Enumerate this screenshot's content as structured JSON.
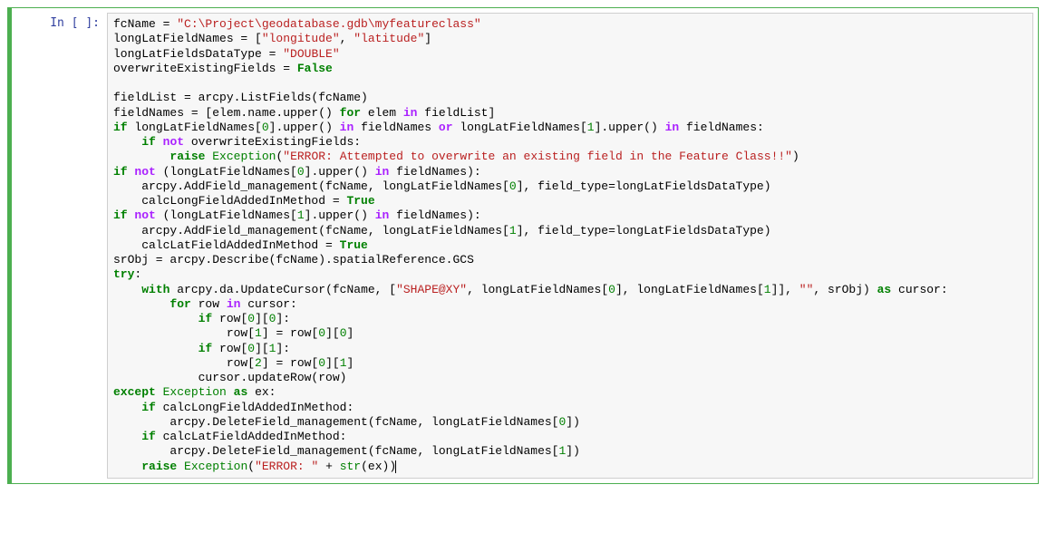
{
  "cell": {
    "prompt": "In [ ]:",
    "code": {
      "l1": {
        "a": "fcName = ",
        "b": "\"C:\\Project\\geodatabase.gdb\\myfeatureclass\""
      },
      "l2": {
        "a": "longLatFieldNames = [",
        "b": "\"longitude\"",
        "c": ", ",
        "d": "\"latitude\"",
        "e": "]"
      },
      "l3": {
        "a": "longLatFieldsDataType = ",
        "b": "\"DOUBLE\""
      },
      "l4": {
        "a": "overwriteExistingFields = ",
        "b": "False"
      },
      "l6": {
        "a": "fieldList = arcpy.ListFields(fcName)"
      },
      "l7": {
        "a": "fieldNames = [elem.name.upper() ",
        "b": "for",
        "c": " elem ",
        "d": "in",
        "e": " fieldList]"
      },
      "l8": {
        "a": "if",
        "b": " longLatFieldNames[",
        "c": "0",
        "d": "].upper() ",
        "e": "in",
        "f": " fieldNames ",
        "g": "or",
        "h": " longLatFieldNames[",
        "i": "1",
        "j": "].upper() ",
        "k": "in",
        "l": " fieldNames:"
      },
      "l9": {
        "a": "    ",
        "b": "if",
        "c": " ",
        "d": "not",
        "e": " overwriteExistingFields:"
      },
      "l10": {
        "a": "        ",
        "b": "raise",
        "c": " ",
        "d": "Exception",
        "e": "(",
        "f": "\"ERROR: Attempted to overwrite an existing field in the Feature Class!!\"",
        "g": ")"
      },
      "l11": {
        "a": "if",
        "b": " ",
        "c": "not",
        "d": " (longLatFieldNames[",
        "e": "0",
        "f": "].upper() ",
        "g": "in",
        "h": " fieldNames):"
      },
      "l12": {
        "a": "    arcpy.AddField_management(fcName, longLatFieldNames[",
        "b": "0",
        "c": "], field_type=longLatFieldsDataType)"
      },
      "l13": {
        "a": "    calcLongFieldAddedInMethod = ",
        "b": "True"
      },
      "l14": {
        "a": "if",
        "b": " ",
        "c": "not",
        "d": " (longLatFieldNames[",
        "e": "1",
        "f": "].upper() ",
        "g": "in",
        "h": " fieldNames):"
      },
      "l15": {
        "a": "    arcpy.AddField_management(fcName, longLatFieldNames[",
        "b": "1",
        "c": "], field_type=longLatFieldsDataType)"
      },
      "l16": {
        "a": "    calcLatFieldAddedInMethod = ",
        "b": "True"
      },
      "l17": {
        "a": "srObj = arcpy.Describe(fcName).spatialReference.GCS"
      },
      "l18": {
        "a": "try",
        "b": ":"
      },
      "l19": {
        "a": "    ",
        "b": "with",
        "c": " arcpy.da.UpdateCursor(fcName, [",
        "d": "\"SHAPE@XY\"",
        "e": ", longLatFieldNames[",
        "f": "0",
        "g": "], longLatFieldNames[",
        "h": "1",
        "i": "]], ",
        "j": "\"\"",
        "k": ", srObj) ",
        "l": "as",
        "m": " cursor:"
      },
      "l20": {
        "a": "        ",
        "b": "for",
        "c": " row ",
        "d": "in",
        "e": " cursor:"
      },
      "l21": {
        "a": "            ",
        "b": "if",
        "c": " row[",
        "d": "0",
        "e": "][",
        "f": "0",
        "g": "]:"
      },
      "l22": {
        "a": "                row[",
        "b": "1",
        "c": "] = row[",
        "d": "0",
        "e": "][",
        "f": "0",
        "g": "]"
      },
      "l23": {
        "a": "            ",
        "b": "if",
        "c": " row[",
        "d": "0",
        "e": "][",
        "f": "1",
        "g": "]:"
      },
      "l24": {
        "a": "                row[",
        "b": "2",
        "c": "] = row[",
        "d": "0",
        "e": "][",
        "f": "1",
        "g": "]"
      },
      "l25": {
        "a": "            cursor.updateRow(row)"
      },
      "l26": {
        "a": "except",
        "b": " ",
        "c": "Exception",
        "d": " ",
        "e": "as",
        "f": " ex:"
      },
      "l27": {
        "a": "    ",
        "b": "if",
        "c": " calcLongFieldAddedInMethod:"
      },
      "l28": {
        "a": "        arcpy.DeleteField_management(fcName, longLatFieldNames[",
        "b": "0",
        "c": "])"
      },
      "l29": {
        "a": "    ",
        "b": "if",
        "c": " calcLatFieldAddedInMethod:"
      },
      "l30": {
        "a": "        arcpy.DeleteField_management(fcName, longLatFieldNames[",
        "b": "1",
        "c": "])"
      },
      "l31": {
        "a": "    ",
        "b": "raise",
        "c": " ",
        "d": "Exception",
        "e": "(",
        "f": "\"ERROR: \"",
        "g": " + ",
        "h": "str",
        "i": "(ex))"
      }
    }
  }
}
